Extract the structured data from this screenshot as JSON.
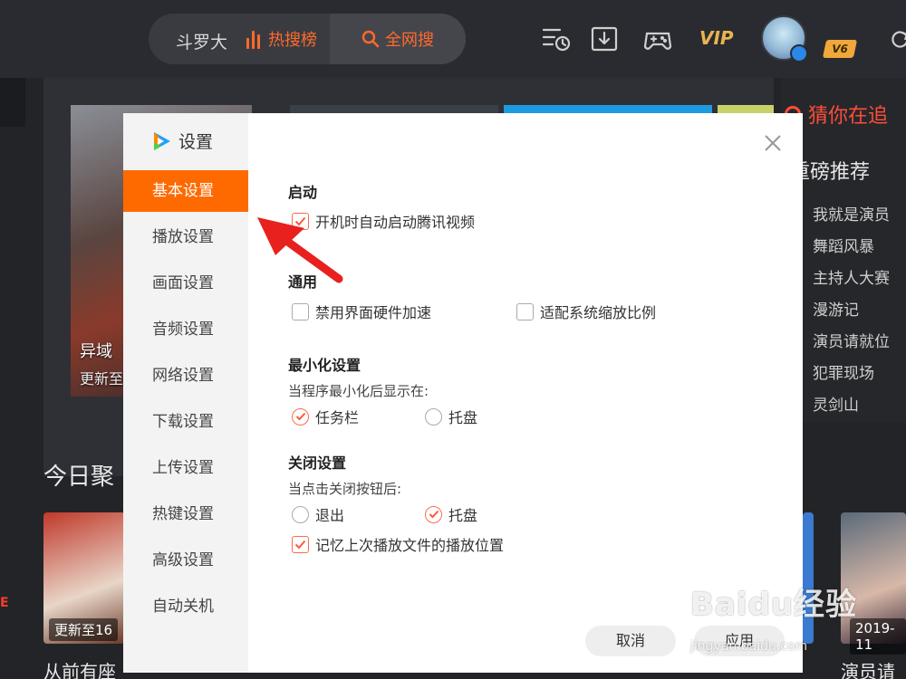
{
  "topbar": {
    "search_query": "斗罗大",
    "hot_label": "热搜榜",
    "search_button": "全网搜",
    "vip_label": "VIP",
    "level_badge": "V6"
  },
  "background": {
    "poster_title": "异域",
    "poster_subtitle": "更新至",
    "guess_title": "猜你在追",
    "recommend_title": "重磅推荐",
    "recommend_items": [
      "我就是演员",
      "舞蹈风暴",
      "主持人大赛",
      "漫游记",
      "演员请就位",
      "犯罪现场",
      "灵剑山"
    ],
    "section_title": "今日聚",
    "card_badge_left": "更新至16",
    "card_badge_right": "2019-11",
    "card_caption_left": "从前有座",
    "card_caption_right": "演员请就",
    "edge_letter": "E"
  },
  "dialog": {
    "title": "设置",
    "nav": [
      "基本设置",
      "播放设置",
      "画面设置",
      "音频设置",
      "网络设置",
      "下载设置",
      "上传设置",
      "热键设置",
      "高级设置",
      "自动关机"
    ],
    "active_nav_index": 0,
    "sections": {
      "startup": {
        "title": "启动",
        "auto_start_label": "开机时自动启动腾讯视频",
        "auto_start_checked": true
      },
      "general": {
        "title": "通用",
        "disable_hw_accel_label": "禁用界面硬件加速",
        "disable_hw_accel_checked": false,
        "fit_scaling_label": "适配系统缩放比例",
        "fit_scaling_checked": false
      },
      "minimize": {
        "title": "最小化设置",
        "desc": "当程序最小化后显示在:",
        "taskbar_label": "任务栏",
        "tray_label": "托盘",
        "selected": "taskbar"
      },
      "close": {
        "title": "关闭设置",
        "desc": "当点击关闭按钮后:",
        "exit_label": "退出",
        "tray_label": "托盘",
        "selected": "tray",
        "remember_position_label": "记忆上次播放文件的播放位置",
        "remember_position_checked": true
      }
    },
    "cancel_button": "取消",
    "apply_button": "应用"
  },
  "watermark": {
    "text": "Baidu经验",
    "url": "jingyan.baidu.com"
  },
  "colors": {
    "accent": "#ff6a00",
    "check": "#ff5a3c",
    "dark_bg": "#232428"
  }
}
